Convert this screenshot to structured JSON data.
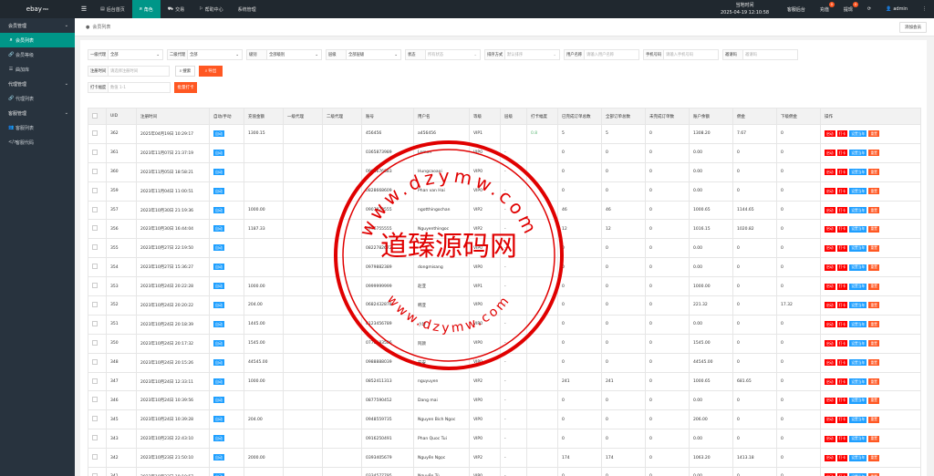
{
  "app": {
    "logo": "ebay",
    "logo_sup": "PRO",
    "top_nav": [
      {
        "label": "后台首页",
        "icon": "home-icon",
        "active": false
      },
      {
        "label": "角色",
        "icon": "user-icon",
        "active": true
      },
      {
        "label": "交易",
        "icon": "cart-icon",
        "active": false
      },
      {
        "label": "帮助中心",
        "icon": "flag-icon",
        "active": false
      },
      {
        "label": "系统管理",
        "icon": "",
        "active": false
      }
    ],
    "clock_label": "当地时间",
    "clock_value": "2025-04-19 12:10:58",
    "top_right": [
      {
        "label": "客服后台",
        "badge": ""
      },
      {
        "label": "充值",
        "badge": "0"
      },
      {
        "label": "提现",
        "badge": "0"
      }
    ],
    "user": "admin"
  },
  "sidebar": [
    {
      "type": "group",
      "label": "会员管理"
    },
    {
      "type": "item",
      "label": "会员列表",
      "icon": "user-icon",
      "active": true
    },
    {
      "type": "item",
      "label": "会员等级",
      "icon": "link-icon",
      "active": false
    },
    {
      "type": "item",
      "label": "曲加库",
      "icon": "list-icon",
      "active": false
    },
    {
      "type": "group",
      "label": "代理管理"
    },
    {
      "type": "item",
      "label": "代理列表",
      "icon": "link-icon",
      "active": false
    },
    {
      "type": "group",
      "label": "客服管理"
    },
    {
      "type": "item",
      "label": "客服列表",
      "icon": "users-icon",
      "active": false
    },
    {
      "type": "item",
      "label": "客服代码",
      "icon": "code-icon",
      "active": false
    }
  ],
  "tabstrip": {
    "tab": "会员列表",
    "add_button": "添加会员"
  },
  "filters": {
    "row1": [
      {
        "label": "一级代理",
        "value": "全部",
        "select": true
      },
      {
        "label": "二级代理",
        "value": "全部",
        "select": true
      },
      {
        "label": "级别",
        "value": "全部级别",
        "select": true
      },
      {
        "label": "层级",
        "value": "全部层级",
        "select": true
      },
      {
        "label": "状态",
        "value": "所有状态",
        "placeholder": true,
        "select": true
      },
      {
        "label": "排序方式",
        "value": "默认排序",
        "placeholder": true,
        "select": true
      },
      {
        "label": "用户名称",
        "value": "请输入用户名称",
        "placeholder": true,
        "select": false
      },
      {
        "label": "手机号码",
        "value": "请输入手机号码",
        "placeholder": true,
        "select": false
      },
      {
        "label": "邀请码",
        "value": "邀请码",
        "placeholder": true,
        "select": false
      }
    ],
    "row2": {
      "label": "注册时间",
      "value": "请选择注册时间",
      "search": "搜索",
      "export": "导出"
    },
    "row3": {
      "label": "打卡幅度",
      "value": "数值 1-1",
      "bulk": "批量打卡"
    }
  },
  "table": {
    "headers": [
      "",
      "UID",
      "注册时间",
      "自动/手动",
      "充值金额",
      "一级代理",
      "二级代理",
      "账号",
      "用户名",
      "等级",
      "层级",
      "打卡幅度",
      "已完成订单总数",
      "全部订单总数",
      "未完成订单数",
      "账户余额",
      "佣金",
      "下级佣金",
      "操作"
    ],
    "tag": "自动",
    "ops": [
      "启动",
      "打卡",
      "设置当年",
      "重置"
    ],
    "rows": [
      [
        "362",
        "2025年04月19日 10:29:17",
        "1300.15",
        "",
        "",
        "456456",
        "a456456",
        "VIP1",
        "",
        "0.8",
        "5",
        "5",
        "0",
        "1308.20",
        "7.67",
        "0"
      ],
      [
        "361",
        "2023年11月07日 21:37:19",
        "",
        "",
        "",
        "0365873989",
        "Lemon",
        "VIP0",
        "-",
        "",
        "0",
        "0",
        "0",
        "0.00",
        "0",
        "0"
      ],
      [
        "360",
        "2023年11月05日 18:58:21",
        "",
        "",
        "",
        "0966676883",
        "Hungcaoaoi",
        "VIP0",
        "-",
        "",
        "0",
        "0",
        "0",
        "0.00",
        "0",
        "0"
      ],
      [
        "359",
        "2023年11月04日 11:00:51",
        "",
        "",
        "",
        "0828668609",
        "Phan van Hai",
        "VIP0",
        "-",
        "",
        "0",
        "0",
        "0",
        "0.00",
        "0",
        "0"
      ],
      [
        "357",
        "2023年10月30日 21:19:36",
        "1000.00",
        "",
        "",
        "0907870555",
        "ngotthingochan",
        "VIP2",
        "-",
        "",
        "46",
        "46",
        "0",
        "1000.65",
        "1144.65",
        "0"
      ],
      [
        "356",
        "2023年10月30日 16:44:04",
        "1187.33",
        "",
        "",
        "0776755555",
        "Nguyenthingoc",
        "VIP2",
        "-",
        "",
        "12",
        "12",
        "0",
        "1016.15",
        "1020.82",
        "0"
      ],
      [
        "355",
        "2023年10月27日 22:19:50",
        "",
        "",
        "",
        "0822782672",
        "",
        "VIP0",
        "-",
        "",
        "0",
        "0",
        "0",
        "0.00",
        "0",
        "0"
      ],
      [
        "354",
        "2023年10月27日 15:36:27",
        "",
        "",
        "",
        "0979882389",
        "dongmisang",
        "VIP0",
        "-",
        "",
        "0",
        "0",
        "0",
        "0.00",
        "0",
        "0"
      ],
      [
        "353",
        "2023年10月24日 20:22:28",
        "1000.00",
        "",
        "",
        "0999999999",
        "赵亚",
        "VIP1",
        "-",
        "",
        "0",
        "0",
        "0",
        "1000.00",
        "0",
        "0"
      ],
      [
        "352",
        "2023年10月24日 20:20:22",
        "204.00",
        "",
        "",
        "0682432878",
        "韩亚",
        "VIP0",
        "-",
        "",
        "0",
        "0",
        "0",
        "221.32",
        "0",
        "17.32"
      ],
      [
        "351",
        "2023年10月24日 20:18:39",
        "1445.00",
        "",
        "",
        "0123456789",
        "小玲",
        "VIP0",
        "-",
        "",
        "0",
        "0",
        "0",
        "0.00",
        "0",
        "0"
      ],
      [
        "350",
        "2023年10月24日 20:17:32",
        "1545.00",
        "",
        "",
        "0775583586",
        "阿颜",
        "VIP0",
        "-",
        "",
        "0",
        "0",
        "0",
        "1545.00",
        "0",
        "0"
      ],
      [
        "348",
        "2023年10月24日 20:15:26",
        "44545.00",
        "",
        "",
        "0988888039",
        "安安",
        "VIP0",
        "-",
        "",
        "0",
        "0",
        "0",
        "44545.00",
        "0",
        "0"
      ],
      [
        "347",
        "2023年10月24日 12:33:11",
        "1000.00",
        "",
        "",
        "0852411313",
        "nguyuyen",
        "VIP2",
        "-",
        "",
        "241",
        "241",
        "0",
        "1000.65",
        "681.65",
        "0"
      ],
      [
        "346",
        "2023年10月24日 10:39:56",
        "",
        "",
        "",
        "0877590452",
        "Dang mai",
        "VIP0",
        "-",
        "",
        "0",
        "0",
        "0",
        "0.00",
        "0",
        "0"
      ],
      [
        "345",
        "2023年10月24日 10:39:28",
        "204.00",
        "",
        "",
        "0948559735",
        "Nguyen Bich Ngoc",
        "VIP0",
        "-",
        "",
        "0",
        "0",
        "0",
        "206.00",
        "0",
        "0"
      ],
      [
        "343",
        "2023年10月23日 22:43:10",
        "",
        "",
        "",
        "0916250491",
        "Phan Quoc Tui",
        "VIP0",
        "-",
        "",
        "0",
        "0",
        "0",
        "0.00",
        "0",
        "0"
      ],
      [
        "342",
        "2023年10月23日 21:50:10",
        "2000.00",
        "",
        "",
        "0393405679",
        "Nguyễn Ngọc",
        "VIP2",
        "-",
        "",
        "174",
        "174",
        "0",
        "1063.20",
        "1413.18",
        "0"
      ],
      [
        "341",
        "2023年10月23日 19:10:57",
        "",
        "",
        "",
        "0334577795",
        "Nguyễn Tú",
        "VIP0",
        "-",
        "",
        "0",
        "0",
        "0",
        "0.00",
        "0",
        "0"
      ]
    ]
  },
  "watermark": {
    "center": "道臻源码网",
    "ring_top": "www.dzymw.com",
    "ring_bottom": "www.dzymw.com"
  }
}
